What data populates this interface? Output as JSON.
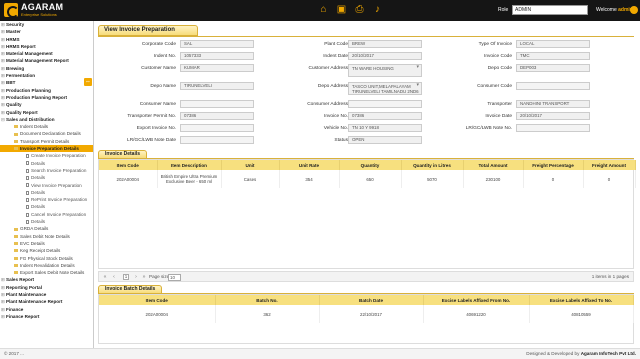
{
  "header": {
    "brand": "AGARAM",
    "brand_sub": "Enterprise Solutions",
    "role_label": "Role",
    "role_value": "ADMIN",
    "welcome_prefix": "Welcome",
    "welcome_user": "admin",
    "icons": [
      "home-icon",
      "briefcase-icon",
      "print-icon",
      "bell-icon"
    ]
  },
  "sidebar": {
    "items": [
      {
        "label": "Security",
        "level": 0
      },
      {
        "label": "Master",
        "level": 0
      },
      {
        "label": "HRMS",
        "level": 0
      },
      {
        "label": "HRMS Report",
        "level": 0
      },
      {
        "label": "Material Management",
        "level": 0
      },
      {
        "label": "Material Management Report",
        "level": 0
      },
      {
        "label": "Brewing",
        "level": 0
      },
      {
        "label": "Fermentation",
        "level": 0
      },
      {
        "label": "BBT",
        "level": 0
      },
      {
        "label": "Production Planning",
        "level": 0
      },
      {
        "label": "Production Planning Report",
        "level": 0
      },
      {
        "label": "Quality",
        "level": 0
      },
      {
        "label": "Quality Report",
        "level": 0
      },
      {
        "label": "Sales and Distribution",
        "level": 0,
        "open": true
      },
      {
        "label": "Indent Details",
        "level": 1
      },
      {
        "label": "Document Declaration Details",
        "level": 1
      },
      {
        "label": "Transport Permit Details",
        "level": 1
      },
      {
        "label": "Invoice Preparation Details",
        "level": 1,
        "selected": true
      },
      {
        "label": "Create Invoice Preparation",
        "level": 2
      },
      {
        "label": "Details",
        "level": 2
      },
      {
        "label": "Search Invoice Preparation",
        "level": 2
      },
      {
        "label": "Details",
        "level": 2
      },
      {
        "label": "View Invoice Preparation",
        "level": 2
      },
      {
        "label": "Details",
        "level": 2
      },
      {
        "label": "RePrint Invoice Preparation",
        "level": 2
      },
      {
        "label": "Details",
        "level": 2
      },
      {
        "label": "Cancel Invoice Preparation",
        "level": 2
      },
      {
        "label": "Details",
        "level": 2
      },
      {
        "label": "GRDA Details",
        "level": 1
      },
      {
        "label": "Sales Debit Note Details",
        "level": 1
      },
      {
        "label": "EVC Details",
        "level": 1
      },
      {
        "label": "Keg Receipt Details",
        "level": 1
      },
      {
        "label": "FG Physical Stock Details",
        "level": 1
      },
      {
        "label": "Indent Revalidation Details",
        "level": 1
      },
      {
        "label": "Export Sales Debit Note Details",
        "level": 1
      },
      {
        "label": "Sales Report",
        "level": 0
      },
      {
        "label": "Reporting Portal",
        "level": 0
      },
      {
        "label": "Plant Maintenance",
        "level": 0
      },
      {
        "label": "Plant Maintenance Report",
        "level": 0
      },
      {
        "label": "Finance",
        "level": 0
      },
      {
        "label": "Finance Report",
        "level": 0
      }
    ]
  },
  "main": {
    "title": "View Invoice Preparation",
    "form": {
      "corporate_code": {
        "label": "Corporate Code",
        "value": "SAL"
      },
      "plant_code": {
        "label": "Plant Code",
        "value": "BREW"
      },
      "type_of_invoice": {
        "label": "Type Of Invoice",
        "value": "LOCAL"
      },
      "indent_no": {
        "label": "Indent No.",
        "value": "1057333"
      },
      "indent_date": {
        "label": "Indent Date",
        "value": "20/10/2017"
      },
      "invoice_code": {
        "label": "Invoice Code",
        "value": "TMC"
      },
      "customer_name": {
        "label": "Customer Name",
        "value": "KUMAR"
      },
      "customer_address": {
        "label": "Customer Address",
        "value": "TN WARE HOUSING"
      },
      "depo_code": {
        "label": "Depo Code",
        "value": "DEP003"
      },
      "depo_name": {
        "label": "Depo Name",
        "value": "TIRUNELVELI"
      },
      "depo_address": {
        "label": "Depo Address",
        "value": "TASCO UNIT,MELAPALAYAM TIRUNELVELI TAMILNADU 2ND6"
      },
      "consumer_code": {
        "label": "Consumer Code",
        "value": ""
      },
      "consumer_name": {
        "label": "Consumer Name",
        "value": ""
      },
      "consumer_address": {
        "label": "Consumer Address",
        "value": ""
      },
      "transporter": {
        "label": "Transporter",
        "value": "NANDHINI TRANSPORT"
      },
      "transporter_permit_no": {
        "label": "Transporter Permit No.",
        "value": "07386"
      },
      "invoice_no": {
        "label": "Invoice No.",
        "value": "07386"
      },
      "invoice_date": {
        "label": "Invoice Date",
        "value": "20/10/2017"
      },
      "export_invoice_no": {
        "label": "Export Invoice No.",
        "value": ""
      },
      "vehicle_no": {
        "label": "Vehicle No.",
        "value": "TN 10 Y 9918"
      },
      "lr_gc_lwb_note_no": {
        "label": "LR/GC/LWB Note No.",
        "value": ""
      },
      "lr_gc_lwb_note_date": {
        "label": "LR/GC/LWB Note Date",
        "value": ""
      },
      "status": {
        "label": "Status",
        "value": "OPEN"
      }
    },
    "invoice_details": {
      "title": "Invoice Details",
      "columns": [
        "Item Code",
        "Item Description",
        "Unit",
        "Unit Rate",
        "Quantity",
        "Quantity in Litres",
        "Total Amount",
        "Freight Percentage",
        "Freight Amount"
      ],
      "rows": [
        [
          "202A00004",
          "British Empire Ultra Premium Exclusive Beer - 650 ml",
          "Cases",
          "354",
          "650",
          "5070",
          "230100",
          "0",
          "0"
        ]
      ],
      "pager": {
        "page": "1",
        "size_label": "Page size:",
        "size": "10",
        "summary": "1 items in 1 pages"
      }
    },
    "batch_details": {
      "title": "Invoice Batch Details",
      "columns": [
        "Item Code",
        "Batch No.",
        "Batch Date",
        "Excise Labels Affixed From No.",
        "Excise Labels Affixed To No."
      ],
      "rows": [
        [
          "202A00004",
          "362",
          "22/10/2017",
          "40691220",
          "40810559"
        ]
      ]
    }
  },
  "footer": {
    "copyright": "© 2017 ...",
    "credit_prefix": "Designed & Developed by",
    "credit_company": "Agaram InfoTech Pvt Ltd."
  }
}
